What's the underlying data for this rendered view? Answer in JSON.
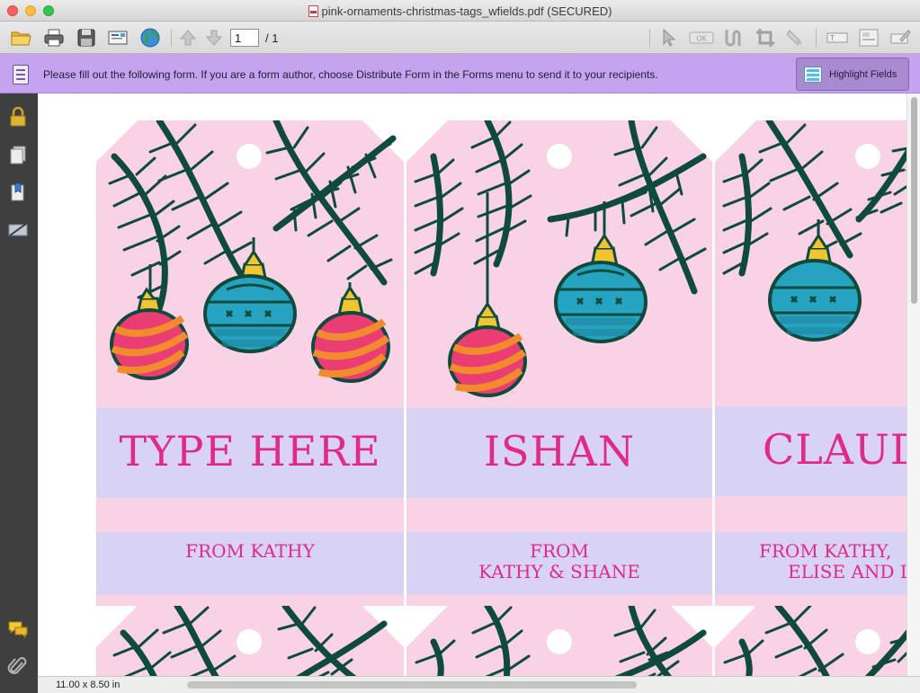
{
  "window": {
    "title": "pink-ornaments-christmas-tags_wfields.pdf (SECURED)"
  },
  "toolbar": {
    "page_current": "1",
    "page_total": "/  1",
    "icons": [
      "open-folder-icon",
      "print-icon",
      "save-disk-icon",
      "email-icon",
      "web-globe-icon",
      "page-up-arrow-icon",
      "page-down-arrow-icon",
      "select-arrow-icon",
      "ok-button-icon",
      "text-select-icon",
      "crop-icon",
      "touchup-icon",
      "text-field-icon",
      "list-field-icon",
      "sign-icon"
    ]
  },
  "formbar": {
    "message": "Please fill out the following form. If you are a form author, choose Distribute Form in the Forms menu to send it to your recipients.",
    "highlight_label": "Highlight Fields"
  },
  "sidebar": {
    "icons": [
      "lock-icon",
      "pages-icon",
      "bookmarks-icon",
      "signatures-icon",
      "comments-icon",
      "attachment-icon"
    ]
  },
  "tags": [
    {
      "name": "TYPE HERE",
      "from_line1": "FROM KATHY",
      "from_line2": ""
    },
    {
      "name": "ISHAN",
      "from_line1": "FROM",
      "from_line2": "KATHY & SHANE"
    },
    {
      "name": "CLAUD",
      "from_line1": "FROM KATHY,",
      "from_line2": "ELISE AND L"
    }
  ],
  "statusbar": {
    "page_size": "11.00 x 8.50 in"
  },
  "colors": {
    "tag_pink": "#f9d3e5",
    "field_lavender": "#d8d2f5",
    "text_pink": "#e02a86",
    "branch_green": "#0e4b3d",
    "ornament_teal": "#27a3c2",
    "ornament_orange": "#f28a2e",
    "ornament_magenta": "#ea3d74",
    "cap_gold": "#f1c531",
    "formbar_purple": "#c5a3ee"
  }
}
